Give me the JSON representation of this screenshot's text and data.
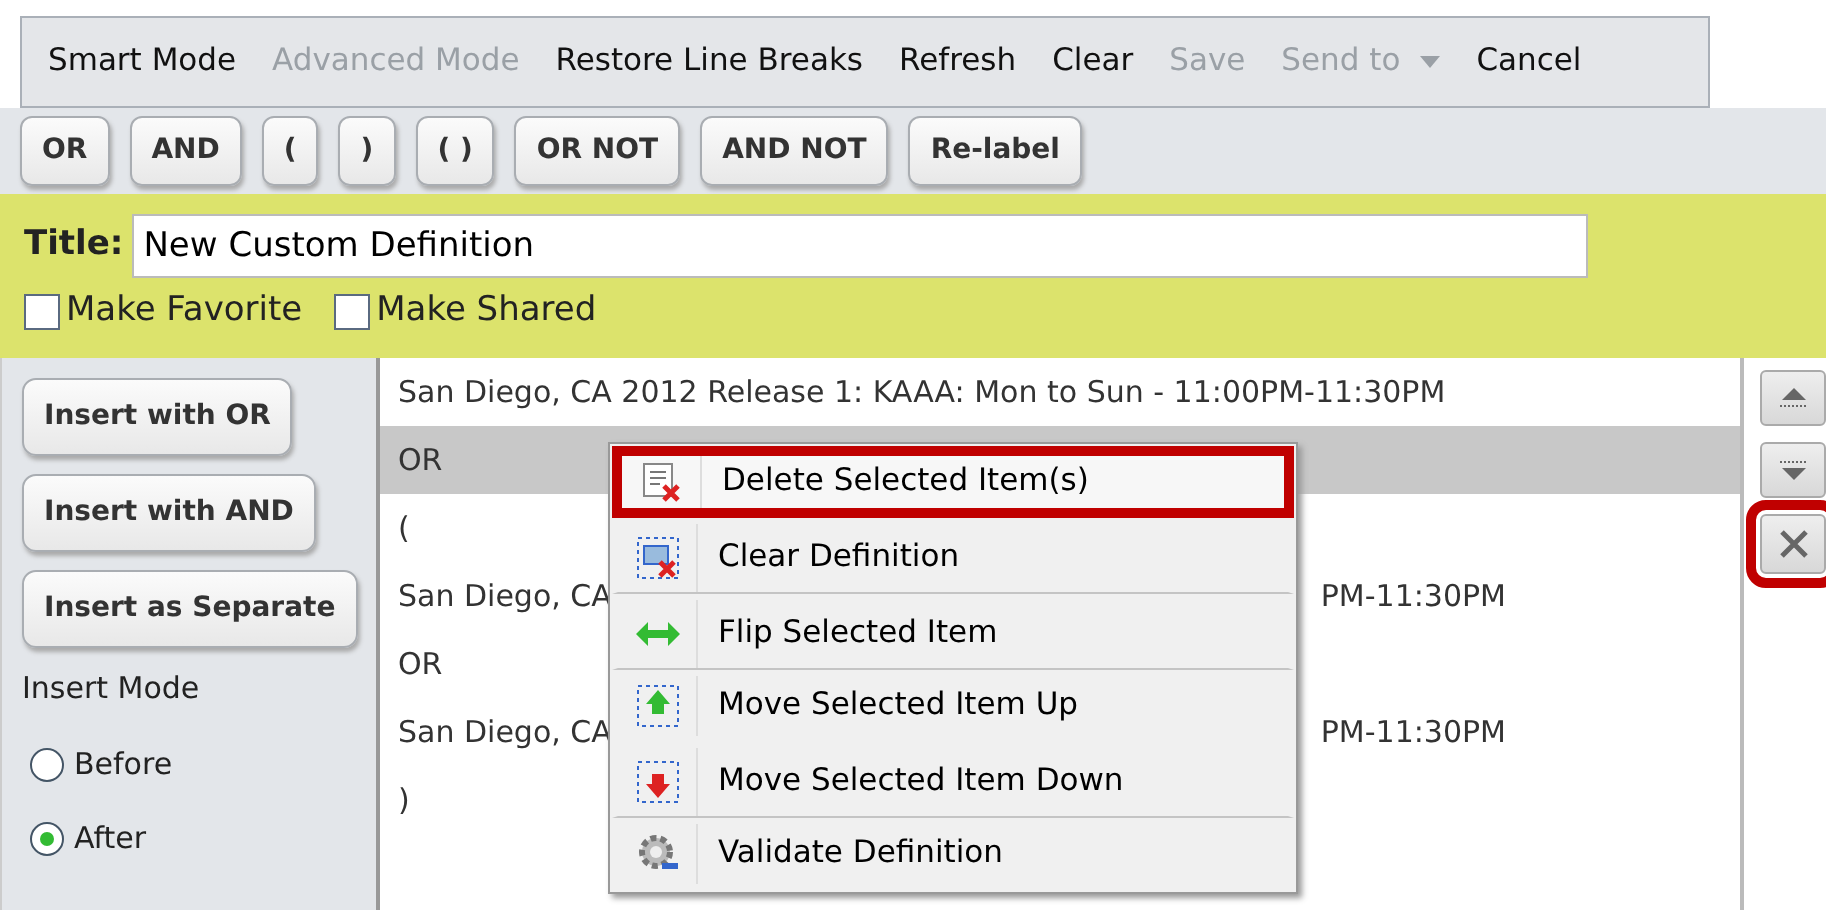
{
  "toolbar": [
    {
      "label": "Smart Mode",
      "disabled": false,
      "kind": "plain"
    },
    {
      "label": "Advanced Mode",
      "disabled": true,
      "kind": "plain"
    },
    {
      "label": "Restore Line Breaks",
      "disabled": false,
      "kind": "plain"
    },
    {
      "label": "Refresh",
      "disabled": false,
      "kind": "plain"
    },
    {
      "label": "Clear",
      "disabled": false,
      "kind": "plain"
    },
    {
      "label": "Save",
      "disabled": true,
      "kind": "plain"
    },
    {
      "label": "Send to",
      "disabled": true,
      "kind": "dropdown"
    },
    {
      "label": "Cancel",
      "disabled": false,
      "kind": "plain"
    }
  ],
  "operators": [
    "OR",
    "AND",
    "(",
    ")",
    "( )",
    "OR NOT",
    "AND NOT",
    "Re-label"
  ],
  "title_panel": {
    "label": "Title:",
    "value": "New Custom Definition",
    "checkboxes": [
      {
        "label": "Make Favorite",
        "checked": false
      },
      {
        "label": "Make Shared",
        "checked": false
      }
    ]
  },
  "insert_buttons": [
    "Insert with OR",
    "Insert with AND",
    "Insert as Separate"
  ],
  "insert_mode": {
    "label": "Insert Mode",
    "options": [
      {
        "label": "Before",
        "selected": false
      },
      {
        "label": "After",
        "selected": true
      }
    ]
  },
  "definition_rows": [
    {
      "text": "San Diego, CA 2012 Release 1: KAAA: Mon to Sun - 11:00PM-11:30PM",
      "selected": false
    },
    {
      "text": "OR",
      "selected": true
    },
    {
      "text": "(",
      "selected": false
    },
    {
      "text": "San Diego, CA",
      "text_right": "PM-11:30PM",
      "selected": false
    },
    {
      "text": "OR",
      "selected": false
    },
    {
      "text": "San Diego, CA",
      "text_right": "PM-11:30PM",
      "selected": false
    },
    {
      "text": ")",
      "selected": false
    }
  ],
  "context_menu": [
    {
      "label": "Delete Selected Item(s)",
      "kind": "delete",
      "highlighted": true,
      "separator_after": false
    },
    {
      "label": "Clear Definition",
      "kind": "clear",
      "highlighted": false,
      "separator_after": true
    },
    {
      "label": "Flip Selected Item",
      "kind": "flip",
      "highlighted": false,
      "separator_after": true
    },
    {
      "label": "Move Selected Item Up",
      "kind": "up",
      "highlighted": false,
      "separator_after": false
    },
    {
      "label": "Move Selected Item Down",
      "kind": "down",
      "highlighted": false,
      "separator_after": true
    },
    {
      "label": "Validate Definition",
      "kind": "validate",
      "highlighted": false,
      "separator_after": false
    }
  ],
  "side_buttons": [
    {
      "kind": "up",
      "highlighted": false
    },
    {
      "kind": "down",
      "highlighted": false
    },
    {
      "kind": "delete",
      "highlighted": true
    }
  ]
}
